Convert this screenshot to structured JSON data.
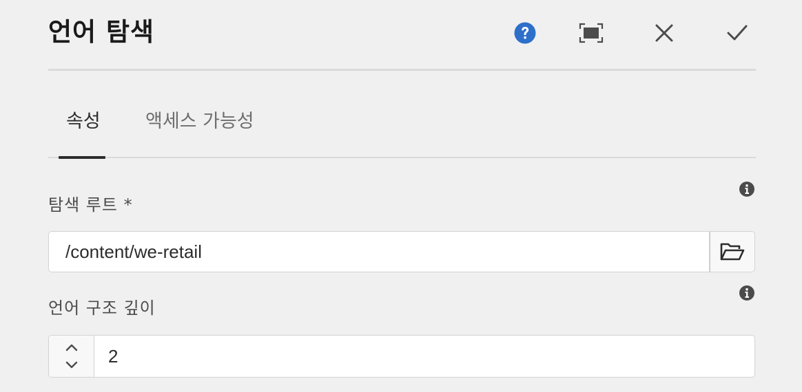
{
  "dialog": {
    "title": "언어 탐색"
  },
  "header_actions": [
    {
      "name": "help",
      "icon": "help-circle-icon",
      "color": "#2d6fc9"
    },
    {
      "name": "fullscreen",
      "icon": "fullscreen-icon"
    },
    {
      "name": "cancel",
      "icon": "close-icon"
    },
    {
      "name": "done",
      "icon": "checkmark-icon"
    }
  ],
  "tabs": [
    {
      "label": "속성",
      "active": true
    },
    {
      "label": "액세스 가능성",
      "active": false
    }
  ],
  "fields": {
    "navigation_root": {
      "label": "탐색 루트 *",
      "value": "/content/we-retail",
      "info_icon": "info-icon",
      "browse_icon": "folder-open-icon"
    },
    "structure_depth": {
      "label": "언어 구조 깊이",
      "value": "2",
      "info_icon": "info-icon",
      "increment_icon": "chevron-up-icon",
      "decrement_icon": "chevron-down-icon"
    }
  }
}
